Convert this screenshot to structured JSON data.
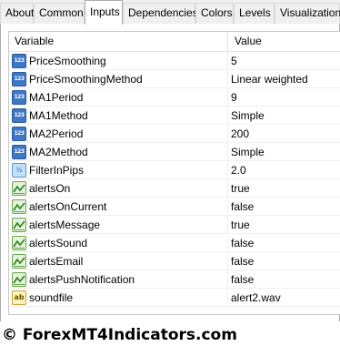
{
  "tabs": [
    "About",
    "Common",
    "Inputs",
    "Dependencies",
    "Colors",
    "Levels",
    "Visualization"
  ],
  "active_tab": "Inputs",
  "table": {
    "headers": {
      "variable": "Variable",
      "value": "Value"
    },
    "rows": [
      {
        "name": "PriceSmoothing",
        "value": "5",
        "icon": "integer-icon",
        "icon_text": "123"
      },
      {
        "name": "PriceSmoothingMethod",
        "value": "Linear weighted",
        "icon": "integer-icon",
        "icon_text": "123"
      },
      {
        "name": "MA1Period",
        "value": "9",
        "icon": "integer-icon",
        "icon_text": "123"
      },
      {
        "name": "MA1Method",
        "value": "Simple",
        "icon": "integer-icon",
        "icon_text": "123"
      },
      {
        "name": "MA2Period",
        "value": "200",
        "icon": "integer-icon",
        "icon_text": "123"
      },
      {
        "name": "MA2Method",
        "value": "Simple",
        "icon": "integer-icon",
        "icon_text": "123"
      },
      {
        "name": "FilterInPips",
        "value": "2.0",
        "icon": "double-icon",
        "icon_text": "½"
      },
      {
        "name": "alertsOn",
        "value": "true",
        "icon": "boolean-icon",
        "icon_text": ""
      },
      {
        "name": "alertsOnCurrent",
        "value": "false",
        "icon": "boolean-icon",
        "icon_text": ""
      },
      {
        "name": "alertsMessage",
        "value": "true",
        "icon": "boolean-icon",
        "icon_text": ""
      },
      {
        "name": "alertsSound",
        "value": "false",
        "icon": "boolean-icon",
        "icon_text": ""
      },
      {
        "name": "alertsEmail",
        "value": "false",
        "icon": "boolean-icon",
        "icon_text": ""
      },
      {
        "name": "alertsPushNotification",
        "value": "false",
        "icon": "boolean-icon",
        "icon_text": ""
      },
      {
        "name": "soundfile",
        "value": "alert2.wav",
        "icon": "string-icon",
        "icon_text": "ab"
      }
    ]
  },
  "watermark": "© ForexMT4Indicators.com"
}
